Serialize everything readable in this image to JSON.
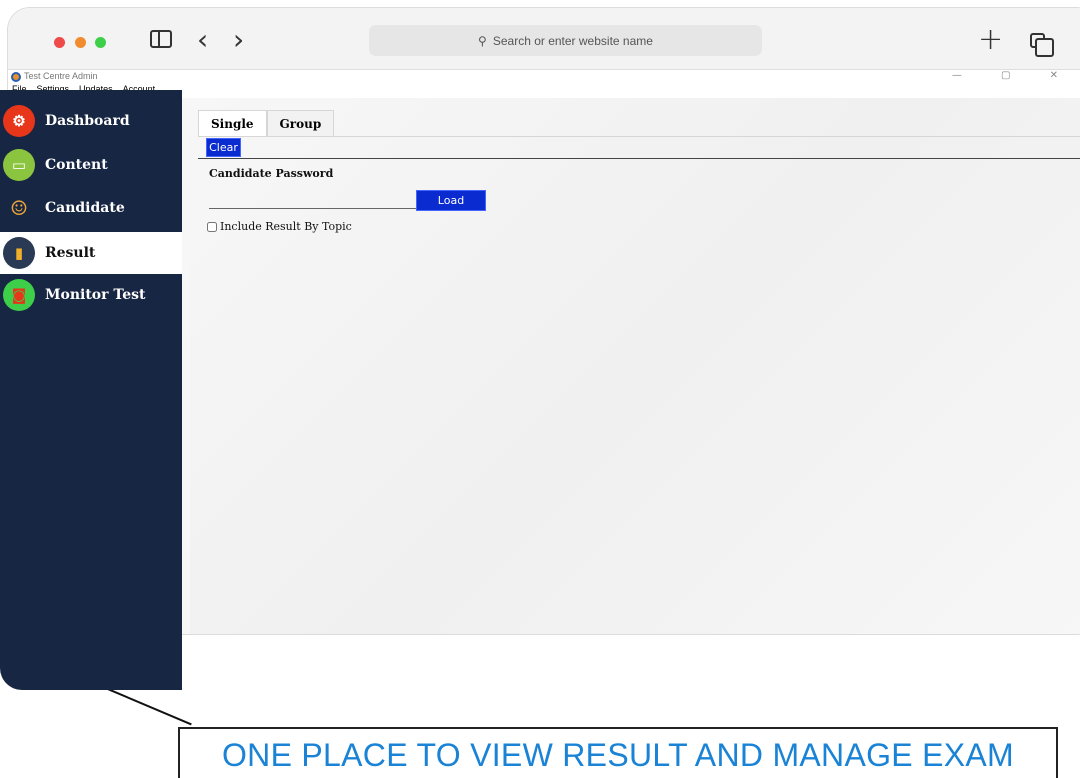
{
  "browser": {
    "url_placeholder": "Search or enter website name"
  },
  "app": {
    "title": "Test Centre Admin",
    "window_controls": "— ▢ ✕"
  },
  "menu": [
    "File",
    "Settings",
    "Updates",
    "Account"
  ],
  "sidebar": {
    "items": [
      {
        "label": "Dashboard",
        "icon": "gear-icon",
        "color": "#e8361a"
      },
      {
        "label": "Content",
        "icon": "monitor-icon",
        "color": "#8bc53f"
      },
      {
        "label": "Candidate",
        "icon": "users-icon",
        "color": "#e8a33a"
      },
      {
        "label": "Result",
        "icon": "bar-chart-icon",
        "color": "#2a3a55",
        "active": true
      },
      {
        "label": "Monitor Test",
        "icon": "monitor-pulse-icon",
        "color": "#3ecf4a"
      }
    ]
  },
  "tabs": [
    {
      "label": "Single",
      "active": true
    },
    {
      "label": "Group",
      "active": false
    }
  ],
  "form": {
    "clear_label": "Clear",
    "password_label": "Candidate Password",
    "password_value": "",
    "load_label": "Load",
    "include_topic_label": "Include Result By Topic",
    "include_topic_checked": false
  },
  "caption": "ONE PLACE TO VIEW RESULT AND MANAGE EXAM",
  "colors": {
    "sidebar_bg": "#172642",
    "button_blue": "#0a2bd0",
    "caption_blue": "#1a83d6"
  }
}
